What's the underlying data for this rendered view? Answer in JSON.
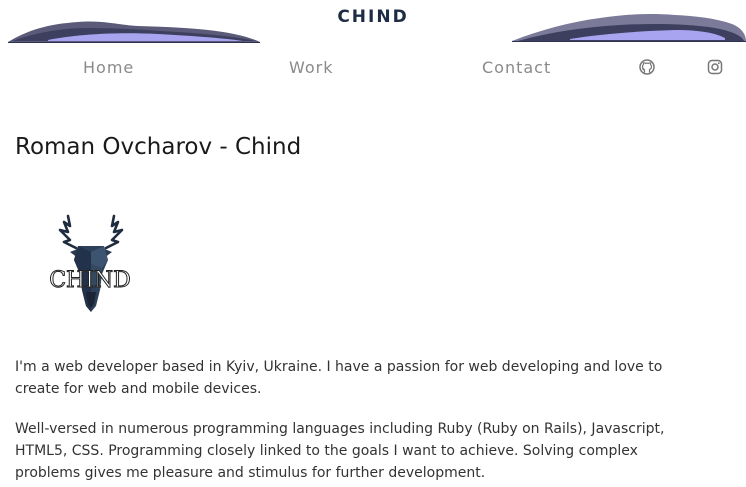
{
  "header": {
    "logo_text": "CHIND",
    "nav": {
      "home": "Home",
      "work": "Work",
      "contact": "Contact"
    },
    "icons": [
      "github-icon",
      "instagram-icon"
    ]
  },
  "main": {
    "title": "Roman Ovcharov - Chind",
    "brand_logo_text": "CHIND",
    "paragraphs": [
      "I'm a web developer based in Kyiv, Ukraine. I have a passion for web developing and love to create for web and mobile devices.",
      "Well-versed in numerous programming languages including Ruby (Ruby on Rails), Javascript, HTML5, CSS. Programming closely linked to the goals I want to achieve. Solving complex problems gives me pleasure and stimulus for further development."
    ]
  },
  "colors": {
    "logo": "#1e2b44",
    "nav": "#8a8a8a",
    "mountain_dark": "#2e3250",
    "mountain_light": "#a9a4f0"
  }
}
